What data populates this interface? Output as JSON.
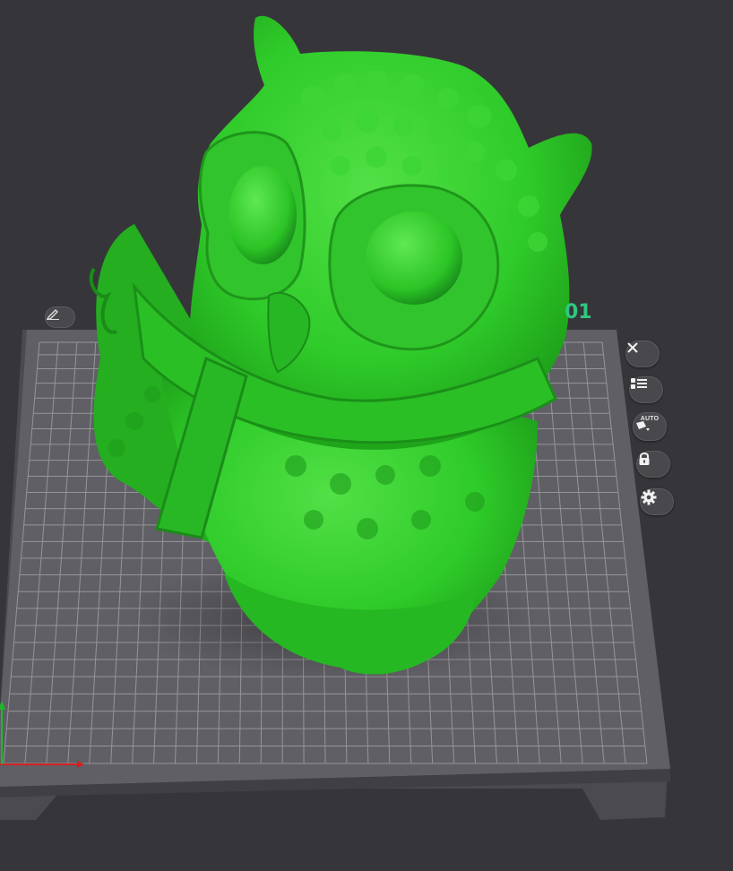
{
  "plate": {
    "label": "01"
  },
  "toolbar": {
    "buttons": [
      {
        "name": "close-button",
        "icon": "close-icon"
      },
      {
        "name": "object-list-button",
        "icon": "list-icon"
      },
      {
        "name": "auto-arrange-button",
        "icon": "auto-arrange-icon",
        "label": "AUTO"
      },
      {
        "name": "lock-button",
        "icon": "lock-icon"
      },
      {
        "name": "settings-button",
        "icon": "gear-icon"
      }
    ]
  },
  "colors": {
    "background": "#36363a",
    "plate": "#5c5c62",
    "grid": "#a7a7ab",
    "model": "#2fcb2a",
    "accent": "#2fc87e",
    "axis_x": "#d42020",
    "axis_y": "#1fb82a"
  }
}
